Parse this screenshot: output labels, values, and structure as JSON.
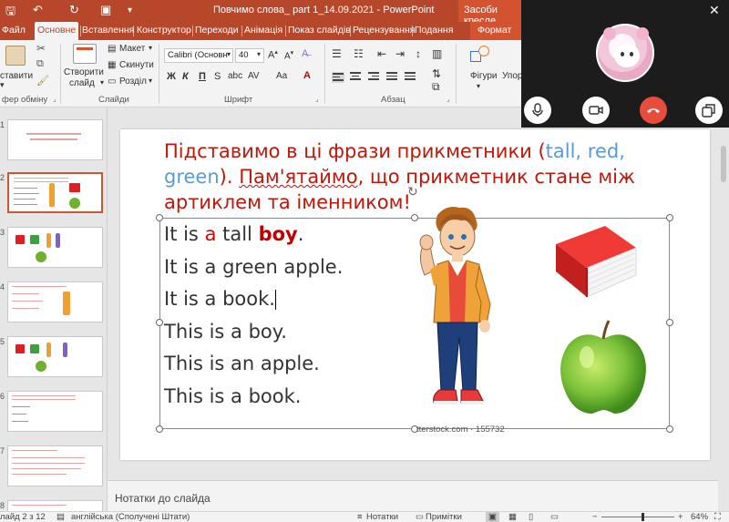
{
  "titlebar": {
    "title": "Повчимо слова_ part 1_14.09.2021 - PowerPoint",
    "tools_title": "Засоби кресле"
  },
  "tabs": [
    {
      "label": "Файл",
      "active": false
    },
    {
      "label": "Основне",
      "active": true
    },
    {
      "label": "Вставлення",
      "active": false
    },
    {
      "label": "Конструктор",
      "active": false
    },
    {
      "label": "Переходи",
      "active": false
    },
    {
      "label": "Анімація",
      "active": false
    },
    {
      "label": "Показ слайдів",
      "active": false
    },
    {
      "label": "Рецензування",
      "active": false
    },
    {
      "label": "Подання",
      "active": false
    },
    {
      "label": "Формат",
      "active": false
    }
  ],
  "ribbon": {
    "paste_label": "ставити",
    "new_slide_label1": "Створити",
    "new_slide_label2": "слайд",
    "layout_label": "Макет",
    "reset_label": "Скинути",
    "section_label": "Розділ",
    "font_name": "Calibri (Основн",
    "font_size": "40",
    "shapes_label": "Фігури",
    "arrange_label": "Упор",
    "groups": {
      "clipboard": "фер обміну",
      "slides": "Слайди",
      "font": "Шрифт",
      "paragraph": "Абзац"
    }
  },
  "thumbnails": [
    {
      "num": "1"
    },
    {
      "num": "2"
    },
    {
      "num": "3"
    },
    {
      "num": "4"
    },
    {
      "num": "5"
    },
    {
      "num": "6"
    },
    {
      "num": "7"
    },
    {
      "num": "8"
    }
  ],
  "slide": {
    "title_part1": "Підставимо в ці фрази прикметники (",
    "title_blue1": "tall, red,",
    "title_blue2": "green",
    "title_part2": "). ",
    "title_wavy": "Пам'ятаймо",
    "title_part3": ", що прикметник стане між артиклем та іменником!",
    "line1_a": "It is ",
    "line1_b": "a",
    "line1_c": " tall ",
    "line1_d": "boy",
    "line1_e": ".",
    "line2": "It is a green apple.",
    "line3": "It is a book.",
    "line4": "This is a boy.",
    "line5": "This is an apple.",
    "line6": "This is a book.",
    "watermark": "tterstock.com · 155732"
  },
  "notes_placeholder": "Нотатки до слайда",
  "status": {
    "slide_indicator": "лайд 2 з 12",
    "language": "англійська (Сполучені Штати)",
    "notes_label": "Нотатки",
    "comments_label": "Примітки",
    "zoom": "64%"
  },
  "colors": {
    "accent": "#b7472a",
    "title_red": "#c0170b",
    "title_blue": "#5b9bd5"
  }
}
